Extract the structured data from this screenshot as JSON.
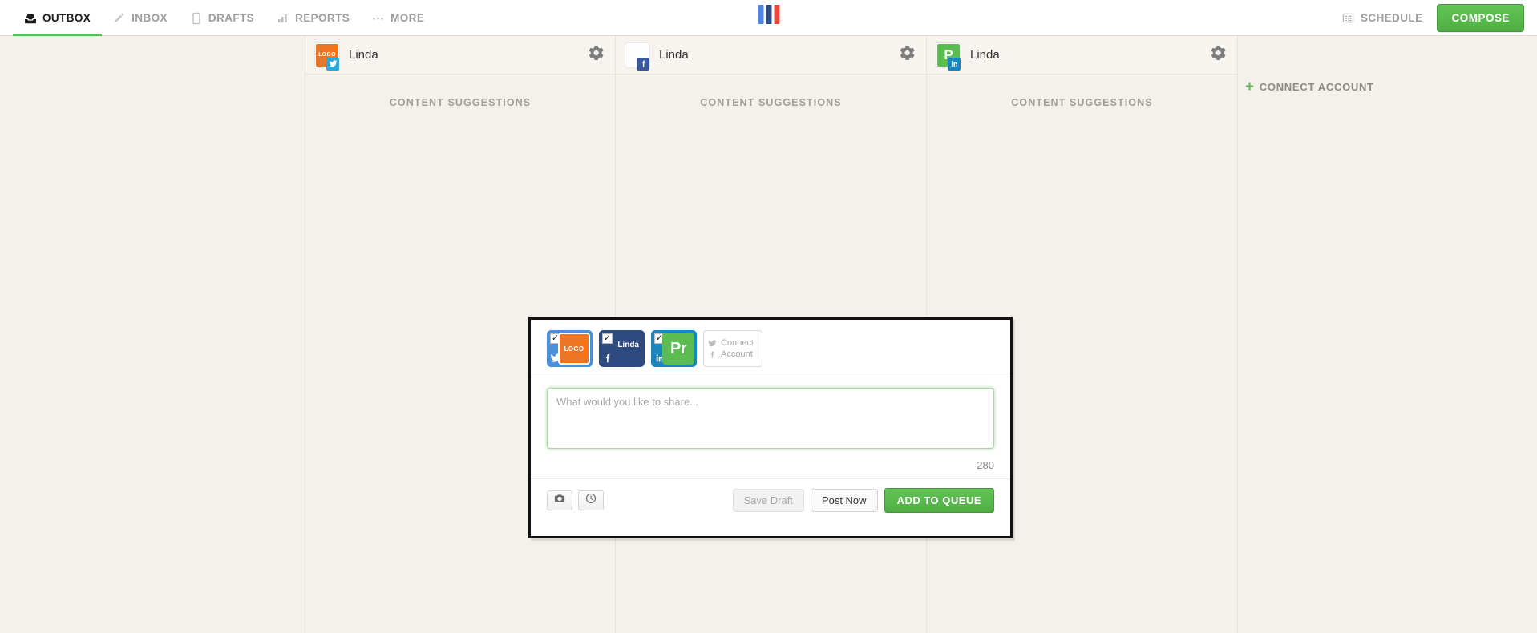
{
  "nav": {
    "items": [
      {
        "label": "OUTBOX",
        "icon": "outbox-icon",
        "active": true
      },
      {
        "label": "INBOX",
        "icon": "inbox-icon",
        "active": false
      },
      {
        "label": "DRAFTS",
        "icon": "drafts-icon",
        "active": false
      },
      {
        "label": "REPORTS",
        "icon": "reports-icon",
        "active": false
      },
      {
        "label": "MORE",
        "icon": "more-icon",
        "active": false
      }
    ],
    "schedule_label": "SCHEDULE",
    "schedule_icon": "calendar-icon",
    "compose_label": "COMPOSE",
    "brand_colors": [
      "#4a86e8",
      "#2b4b86",
      "#e8483c"
    ],
    "accent_green": "#56b94a"
  },
  "board": {
    "columns": [
      {
        "name": "Linda",
        "avatar_text": "LOGO",
        "avatar_style": "orange",
        "network": "twitter",
        "suggestions_label": "CONTENT SUGGESTIONS",
        "gear_icon": "gear-icon"
      },
      {
        "name": "Linda",
        "avatar_text": "",
        "avatar_style": "white",
        "network": "facebook",
        "suggestions_label": "CONTENT SUGGESTIONS",
        "gear_icon": "gear-icon"
      },
      {
        "name": "Linda",
        "avatar_text": "P",
        "avatar_style": "green",
        "network": "linkedin",
        "suggestions_label": "CONTENT SUGGESTIONS",
        "gear_icon": "gear-icon"
      }
    ],
    "connect_account_label": "CONNECT ACCOUNT",
    "connect_plus": "+"
  },
  "compose": {
    "accounts": [
      {
        "network": "twitter",
        "checked": "✓",
        "avatar_text": "LOGO",
        "avatar_style": "orange",
        "name_text": ""
      },
      {
        "network": "facebook",
        "checked": "✓",
        "avatar_text": "",
        "avatar_style": "none",
        "name_text": "Linda"
      },
      {
        "network": "linkedin",
        "checked": "✓",
        "avatar_text": "Pr",
        "avatar_style": "green",
        "name_text": ""
      }
    ],
    "connect_tile": {
      "line1": "Connect",
      "line2": "Account"
    },
    "placeholder": "What would you like to share...",
    "value": "",
    "char_count": "280",
    "photo_icon": "camera-icon",
    "time_icon": "clock-icon",
    "save_draft_label": "Save Draft",
    "post_now_label": "Post Now",
    "add_to_queue_label": "ADD TO QUEUE"
  }
}
